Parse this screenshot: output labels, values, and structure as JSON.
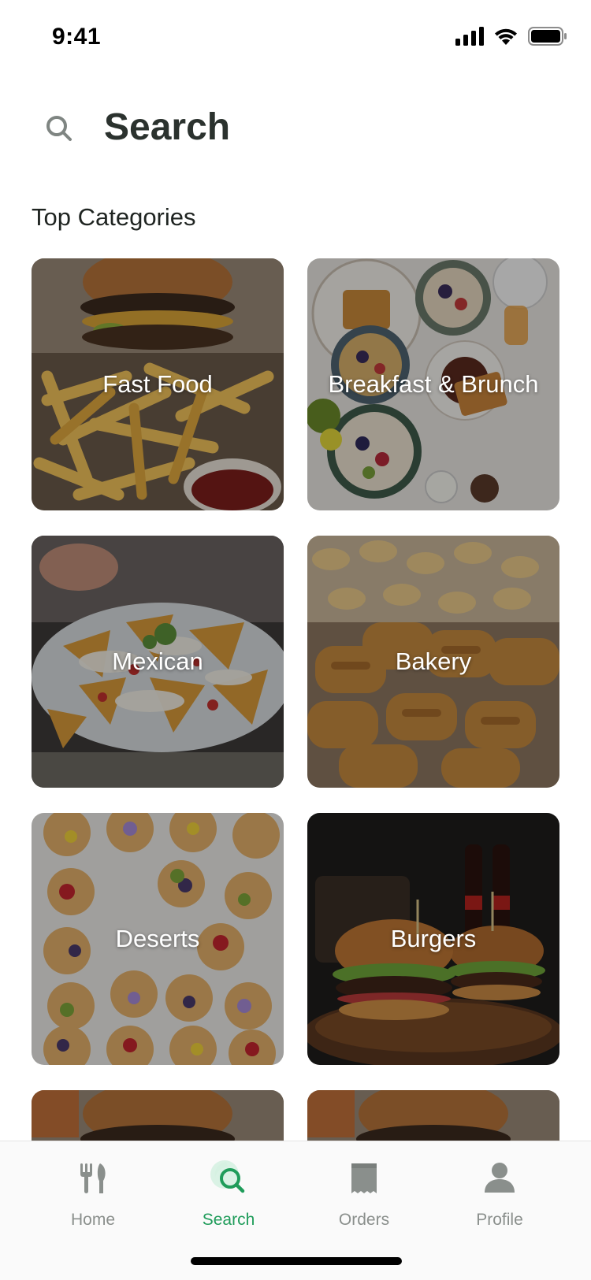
{
  "status_bar": {
    "time": "9:41",
    "icons": [
      "cellular-signal-icon",
      "wifi-icon",
      "battery-icon"
    ]
  },
  "header": {
    "title": "Search",
    "icon": "search-icon"
  },
  "section": {
    "title": "Top Categories"
  },
  "categories": [
    {
      "label": "Fast Food",
      "image": "burger-and-fries-photo"
    },
    {
      "label": "Breakfast & Brunch",
      "image": "breakfast-table-photo"
    },
    {
      "label": "Mexican",
      "image": "nachos-photo"
    },
    {
      "label": "Bakery",
      "image": "pastries-tray-photo"
    },
    {
      "label": "Deserts",
      "image": "fruit-tarts-photo"
    },
    {
      "label": "Burgers",
      "image": "burgers-on-board-photo"
    },
    {
      "label": "",
      "image": "burger-and-fries-photo"
    },
    {
      "label": "",
      "image": "burger-and-fries-photo"
    }
  ],
  "tab_bar": {
    "active": "Search",
    "accent_color": "#1f9c5a",
    "inactive_color": "#8a8f8c",
    "items": [
      {
        "label": "Home",
        "icon": "fork-knife-icon"
      },
      {
        "label": "Search",
        "icon": "search-icon"
      },
      {
        "label": "Orders",
        "icon": "receipt-icon"
      },
      {
        "label": "Profile",
        "icon": "person-icon"
      }
    ]
  }
}
